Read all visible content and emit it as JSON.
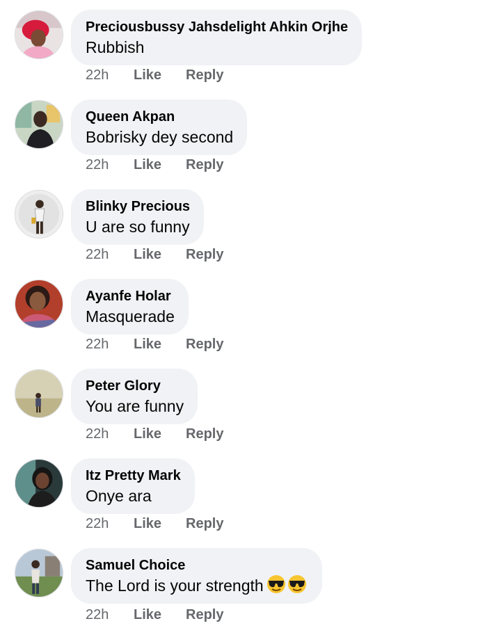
{
  "colors": {
    "bubble_bg": "#f0f2f5",
    "meta_text": "#65676b",
    "name_text": "#050505"
  },
  "comments": [
    {
      "author": "Preciousbussy Jahsdelight Ahkin Orjhe",
      "text": "Rubbish",
      "time": "22h",
      "like_label": "Like",
      "reply_label": "Reply",
      "avatar_icon": "profile-photo-red-headwrap"
    },
    {
      "author": "Queen Akpan",
      "text": "Bobrisky dey second",
      "time": "22h",
      "like_label": "Like",
      "reply_label": "Reply",
      "avatar_icon": "profile-photo-indoor"
    },
    {
      "author": "Blinky Precious",
      "text": "U are so funny",
      "time": "22h",
      "like_label": "Like",
      "reply_label": "Reply",
      "avatar_icon": "profile-photo-standing"
    },
    {
      "author": "Ayanfe Holar",
      "text": "Masquerade",
      "time": "22h",
      "like_label": "Like",
      "reply_label": "Reply",
      "avatar_icon": "profile-photo-selfie"
    },
    {
      "author": "Peter Glory",
      "text": "You are funny",
      "time": "22h",
      "like_label": "Like",
      "reply_label": "Reply",
      "avatar_icon": "profile-photo-outdoor-wall"
    },
    {
      "author": "Itz Pretty Mark",
      "text": "Onye ara",
      "time": "22h",
      "like_label": "Like",
      "reply_label": "Reply",
      "avatar_icon": "profile-photo-dark"
    },
    {
      "author": "Samuel Choice",
      "text": "The Lord is your strength",
      "time": "22h",
      "like_label": "Like",
      "reply_label": "Reply",
      "avatar_icon": "profile-photo-outdoor-field",
      "emoji": [
        "sunglasses-emoji",
        "sunglasses-emoji"
      ]
    }
  ]
}
